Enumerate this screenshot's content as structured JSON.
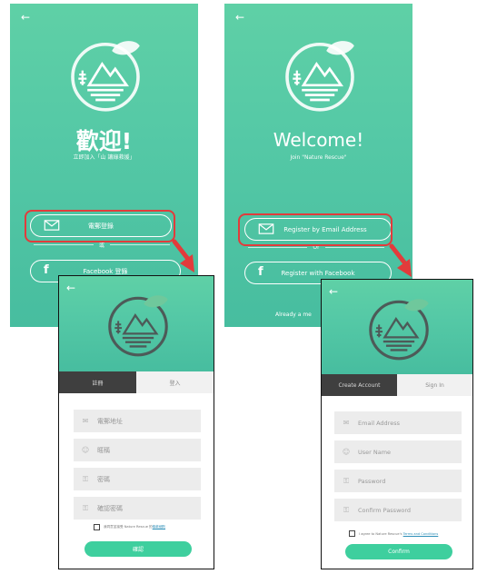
{
  "colors": {
    "gradient_top": "#5fd0a6",
    "gradient_bottom": "#47bd9f",
    "highlight": "#e23b3b",
    "confirm_button": "#3ecf9e",
    "active_tab": "#3f3f3f"
  },
  "zh": {
    "welcome_title": "歡迎!",
    "welcome_subtitle": "立即加入「山 讓綠救援」",
    "email_button": "電郵登錄",
    "or": "或",
    "facebook_button": "Facebook 登錄",
    "tabs": [
      "註冊",
      "登入"
    ],
    "fields": [
      {
        "placeholder": "電郵地址",
        "icon": "mail-icon"
      },
      {
        "placeholder": "暱稱",
        "icon": "user-icon"
      },
      {
        "placeholder": "密碼",
        "icon": "lock-icon"
      },
      {
        "placeholder": "確認密碼",
        "icon": "lock-icon"
      }
    ],
    "agree_text": "我同意並接受 Nature Rescue 的",
    "agree_link": "條款細則",
    "confirm": "確認"
  },
  "en": {
    "welcome_title": "Welcome!",
    "welcome_subtitle": "Join \"Nature Rescue\"",
    "email_button": "Register by Email Address",
    "or": "Or",
    "facebook_button": "Register with Facebook",
    "footer_partial": "Already a me",
    "tabs": [
      "Create Account",
      "Sign In"
    ],
    "fields": [
      {
        "placeholder": "Email Address",
        "icon": "mail-icon"
      },
      {
        "placeholder": "User Name",
        "icon": "user-icon"
      },
      {
        "placeholder": "Password",
        "icon": "lock-icon"
      },
      {
        "placeholder": "Confirm Password",
        "icon": "lock-icon"
      }
    ],
    "agree_text": "I agree to Nature Rescue's",
    "agree_link": "Terms and Conditions",
    "confirm": "Confirm"
  },
  "icons": {
    "back": "back-arrow-icon",
    "logo": "nature-rescue-logo",
    "mail": "mail-icon",
    "facebook": "facebook-icon",
    "flow_arrow": "red-arrow-icon"
  }
}
